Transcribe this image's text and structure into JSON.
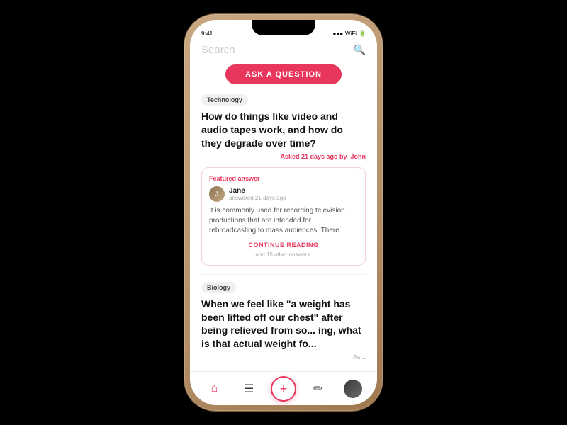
{
  "phone": {
    "search": {
      "placeholder": "Search",
      "icon": "🔍"
    },
    "askButton": "ASK A QUESTION",
    "questions": [
      {
        "id": "q1",
        "category": "Technology",
        "title": "How do things like video and audio tapes work, and how do they degrade over time?",
        "meta": "Asked 21 days ago by",
        "author": "John",
        "featuredAnswer": {
          "label": "Featured answer",
          "answerer": "Jane",
          "answererDate": "answered 21 days ago",
          "text": "It is commonly used for recording television productions that are intended for rebroadcasting to mass audiences. There",
          "continueReading": "CONTINUE READING",
          "otherAnswers": "and 15 other answers."
        }
      },
      {
        "id": "q2",
        "category": "Biology",
        "title": "When we feel like \"a weight has been lifted off our chest\" after being relieved from so... ing, what is that actual weight fo...",
        "meta": "As..."
      }
    ],
    "nav": {
      "items": [
        {
          "icon": "home",
          "label": "Home",
          "active": true
        },
        {
          "icon": "list",
          "label": "Feed",
          "active": false
        },
        {
          "icon": "fab",
          "label": "Add",
          "active": false
        },
        {
          "icon": "edit",
          "label": "Write",
          "active": false
        },
        {
          "icon": "profile",
          "label": "Profile",
          "active": false
        }
      ]
    }
  }
}
